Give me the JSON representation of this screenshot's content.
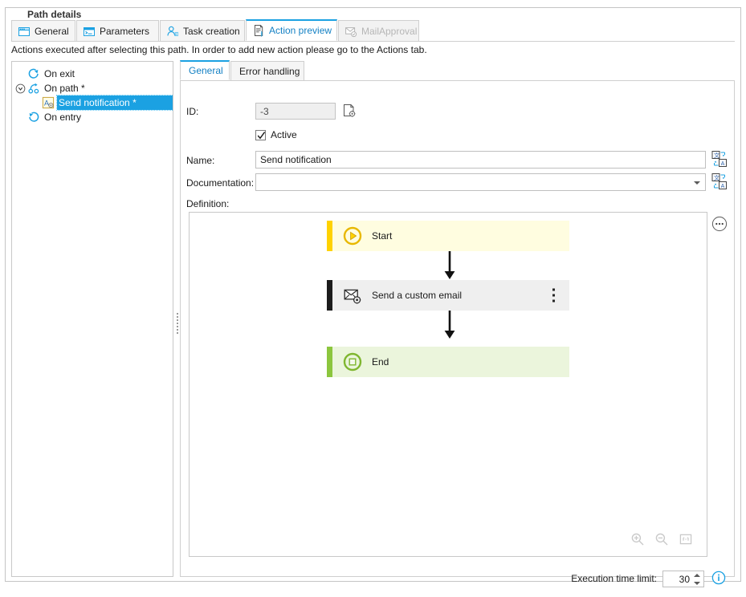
{
  "groupbox": {
    "title": "Path details"
  },
  "tabs": [
    {
      "label": "General",
      "icon": "window-icon",
      "state": "normal"
    },
    {
      "label": "Parameters",
      "icon": "console-icon",
      "state": "normal"
    },
    {
      "label": "Task creation",
      "icon": "user-task-icon",
      "state": "normal"
    },
    {
      "label": "Action preview",
      "icon": "script-icon",
      "state": "active"
    },
    {
      "label": "MailApproval",
      "icon": "mail-check-icon",
      "state": "disabled"
    }
  ],
  "description": "Actions executed after selecting this path. In order to add new action please go to the Actions tab.",
  "tree": {
    "items": [
      {
        "label": "On exit",
        "icon": "on-exit-icon",
        "indent": 1,
        "selected": false,
        "expander": "none"
      },
      {
        "label": "On path *",
        "icon": "on-path-icon",
        "indent": 0,
        "selected": false,
        "expander": "collapse"
      },
      {
        "label": "Send notification *",
        "icon": "action-icon",
        "indent": 2,
        "selected": true,
        "expander": "none"
      },
      {
        "label": "On entry",
        "icon": "on-entry-icon",
        "indent": 1,
        "selected": false,
        "expander": "none"
      }
    ]
  },
  "inner_tabs": [
    {
      "label": "General",
      "state": "active"
    },
    {
      "label": "Error handling",
      "state": "normal"
    }
  ],
  "form": {
    "id_label": "ID:",
    "id_value": "-3",
    "id_icon": "page-settings-icon",
    "active_label": "Active",
    "active_checked": true,
    "name_label": "Name:",
    "name_value": "Send notification",
    "name_translate_icon": "translate-icon",
    "documentation_label": "Documentation:",
    "documentation_value": "",
    "documentation_placeholder": "",
    "documentation_translate_icon": "translate-icon",
    "definition_label": "Definition:"
  },
  "canvas": {
    "more_icon": "more-options-circle-icon",
    "nodes": [
      {
        "label": "Start",
        "icon": "play-circle-icon",
        "accent": "#FFD200",
        "fill": "#FFFDE0",
        "type": "start",
        "has_menu": false
      },
      {
        "label": "Send a custom email",
        "icon": "mail-gear-icon",
        "accent": "#1c1c1c",
        "fill": "#EFEFEF",
        "type": "action",
        "has_menu": true
      },
      {
        "label": "End",
        "icon": "stop-circle-icon",
        "accent": "#8CC63E",
        "fill": "#EBF5DC",
        "type": "end",
        "has_menu": false
      }
    ],
    "tools": [
      {
        "name": "zoom-in-icon",
        "enabled": false
      },
      {
        "name": "zoom-out-icon",
        "enabled": false
      },
      {
        "name": "zoom-reset-icon",
        "enabled": false
      }
    ]
  },
  "footer": {
    "execution_time_limit_label": "Execution time limit:",
    "execution_time_limit_value": "30",
    "info_icon": "info-circle-icon"
  }
}
